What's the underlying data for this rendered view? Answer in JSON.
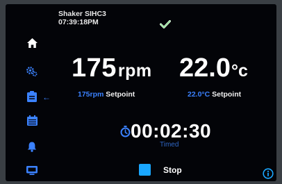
{
  "header": {
    "device_name": "Shaker SIHC3",
    "clock": "07:39:18PM",
    "status_icon": "check-icon"
  },
  "sidebar": {
    "items": [
      {
        "name": "home",
        "icon": "home-icon"
      },
      {
        "name": "settings",
        "icon": "gears-icon"
      },
      {
        "name": "program",
        "icon": "clipboard-icon",
        "active": true
      },
      {
        "name": "calendar",
        "icon": "calendar-icon"
      },
      {
        "name": "alarm",
        "icon": "bell-icon"
      },
      {
        "name": "display",
        "icon": "monitor-icon"
      }
    ],
    "active_indicator": "←"
  },
  "speed": {
    "value": "175",
    "unit": "rpm",
    "setpoint_value": "175rpm",
    "setpoint_label": "Setpoint"
  },
  "temperature": {
    "value": "22.0",
    "unit": "°c",
    "setpoint_value": "22.0°C",
    "setpoint_label": "Setpoint"
  },
  "timer": {
    "value": "00:02:30",
    "mode": "Timed",
    "icon": "stopwatch-icon"
  },
  "controls": {
    "stop_label": "Stop"
  },
  "colors": {
    "accent": "#3b82ff",
    "stop": "#1aa7ff",
    "check": "#2fc23a"
  }
}
